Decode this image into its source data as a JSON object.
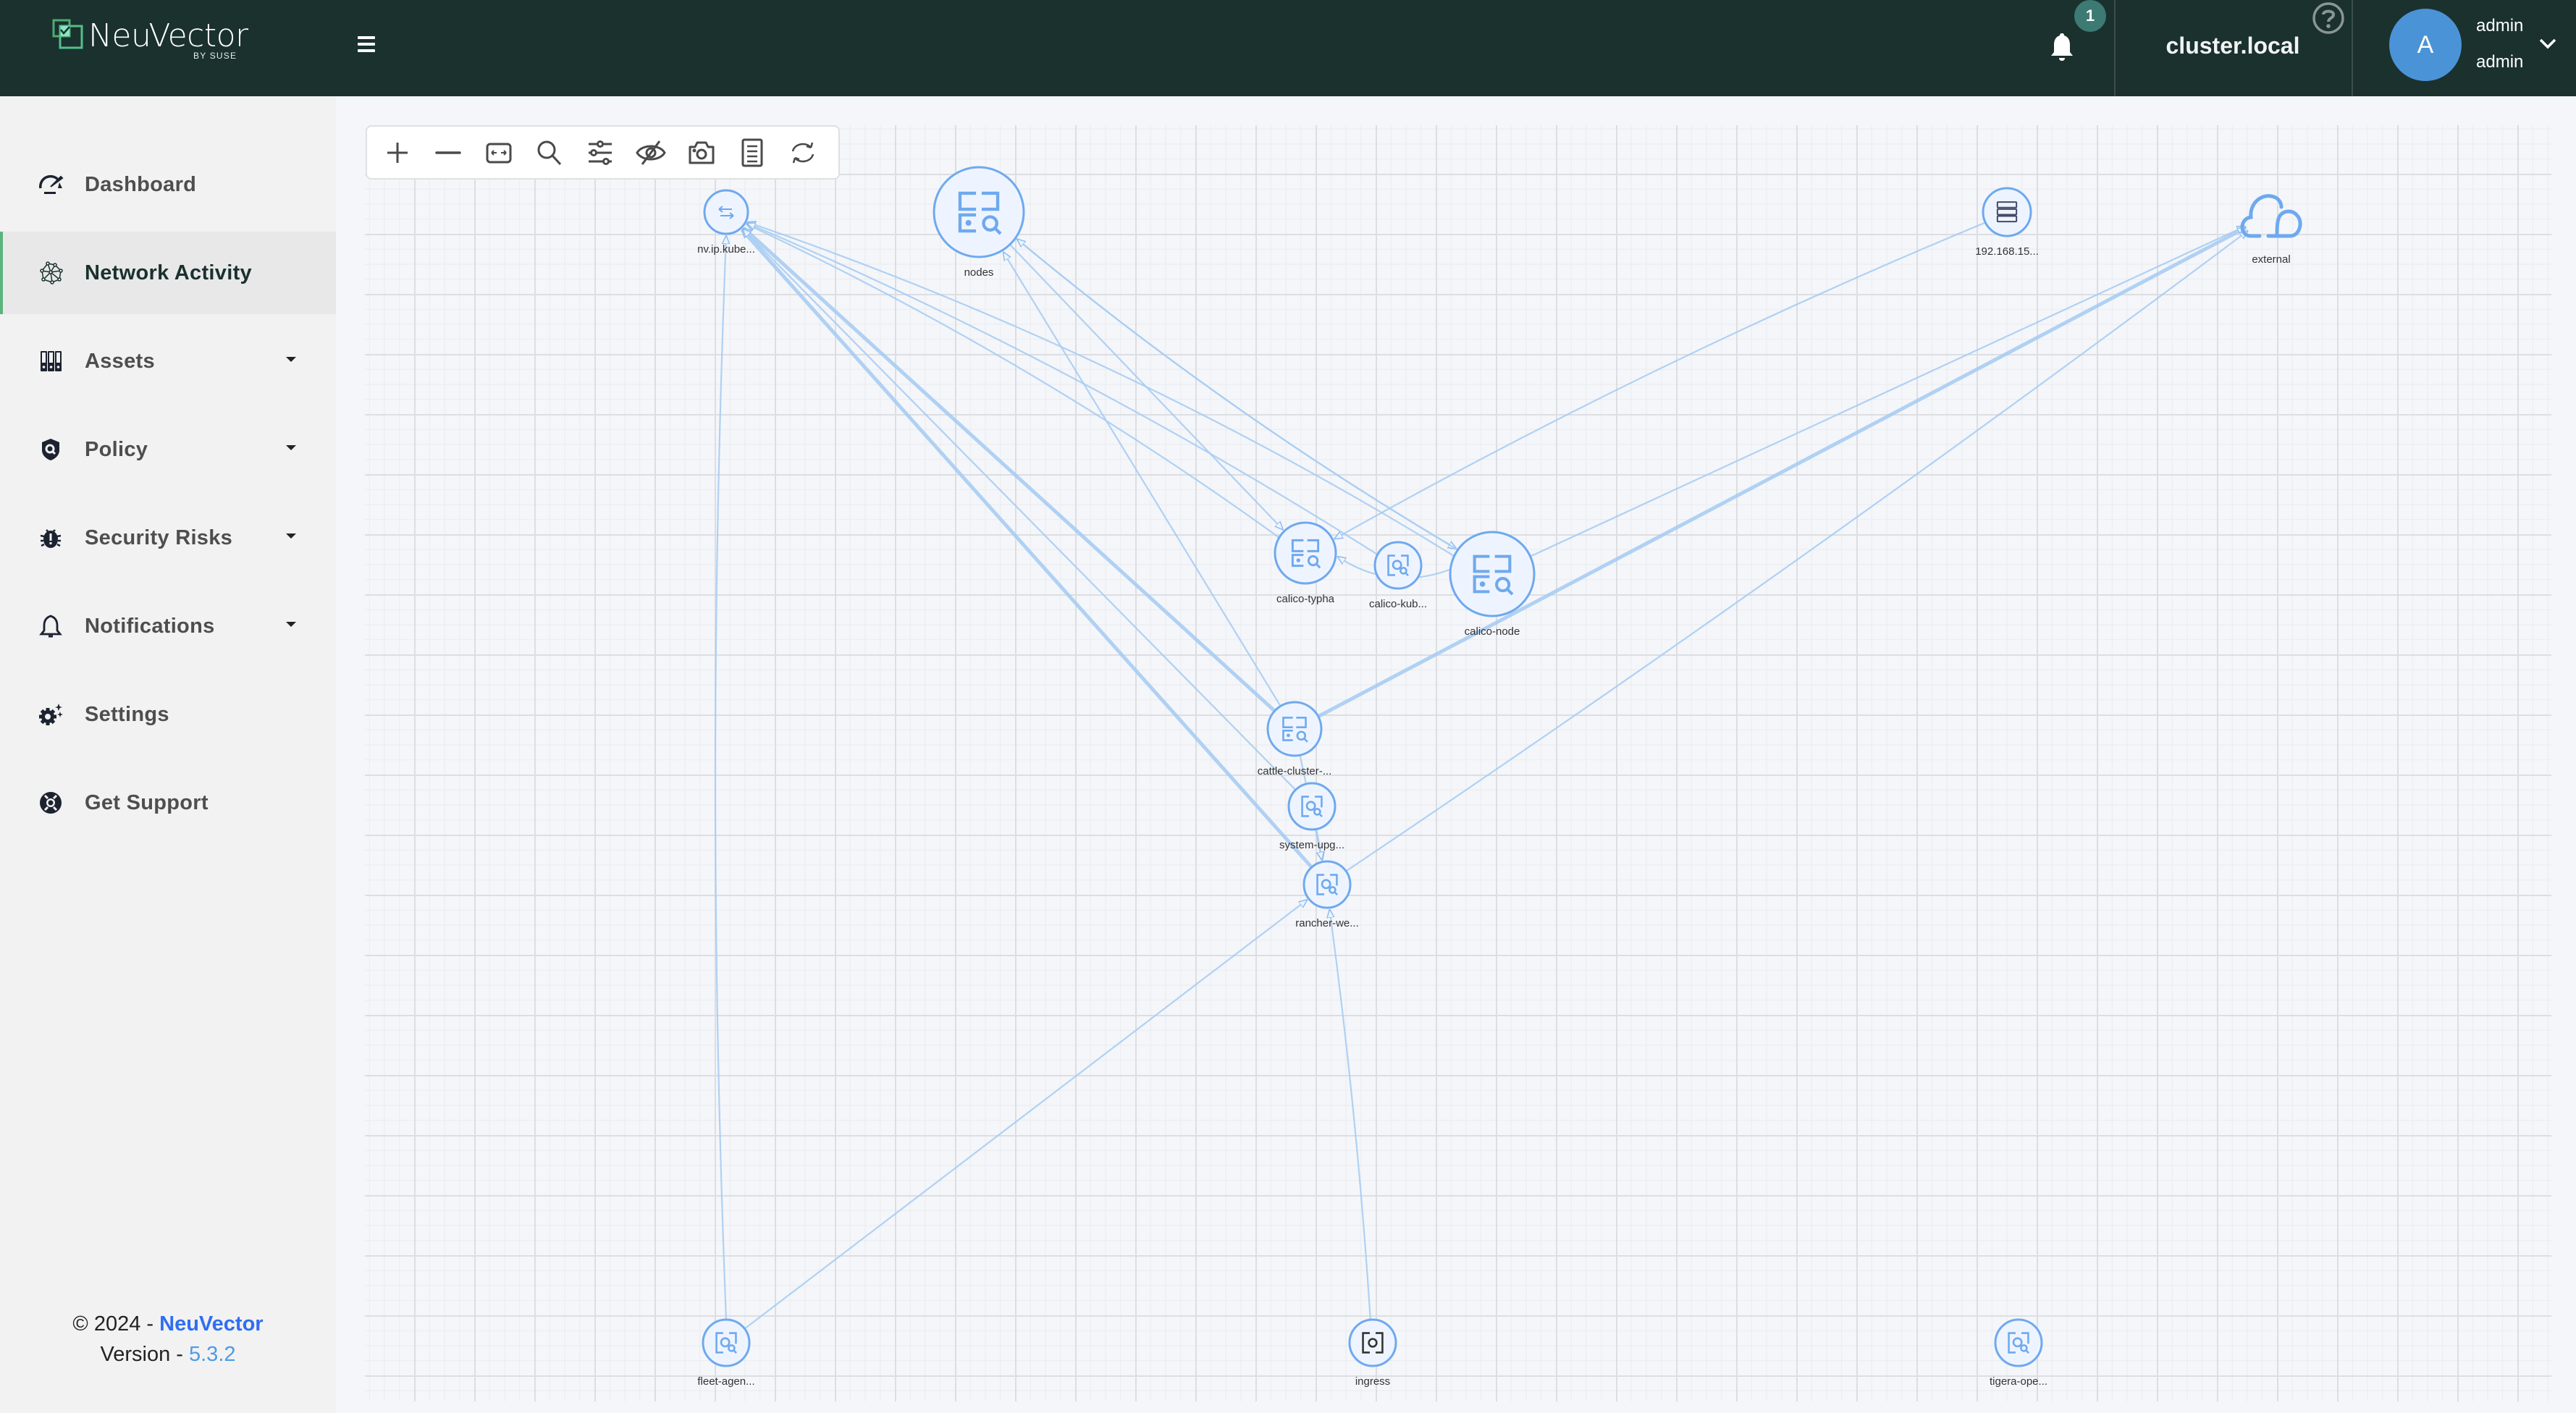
{
  "header": {
    "logo_text": "NeuVector",
    "logo_sub": "BY SUSE",
    "notification_count": "1",
    "cluster_name": "cluster.local",
    "avatar_initial": "A",
    "user_name": "admin",
    "user_role": "admin"
  },
  "sidebar": {
    "items": [
      {
        "label": "Dashboard",
        "icon": "dashboard-gauge-icon",
        "active": false,
        "has_submenu": false
      },
      {
        "label": "Network Activity",
        "icon": "network-activity-icon",
        "active": true,
        "has_submenu": false
      },
      {
        "label": "Assets",
        "icon": "assets-icon",
        "active": false,
        "has_submenu": true
      },
      {
        "label": "Policy",
        "icon": "policy-shield-icon",
        "active": false,
        "has_submenu": true
      },
      {
        "label": "Security Risks",
        "icon": "bug-icon",
        "active": false,
        "has_submenu": true
      },
      {
        "label": "Notifications",
        "icon": "bell-icon",
        "active": false,
        "has_submenu": true
      },
      {
        "label": "Settings",
        "icon": "gear-icon",
        "active": false,
        "has_submenu": false
      },
      {
        "label": "Get Support",
        "icon": "lifebuoy-icon",
        "active": false,
        "has_submenu": false
      }
    ],
    "footer": {
      "copyright": "© 2024 - ",
      "brand_link": "NeuVector",
      "version_label": "Version - ",
      "version": "5.3.2"
    }
  },
  "toolbar": {
    "buttons": [
      {
        "name": "zoom-in",
        "icon": "plus-icon"
      },
      {
        "name": "zoom-out",
        "icon": "minus-icon"
      },
      {
        "name": "fit-view",
        "icon": "fit-width-icon"
      },
      {
        "name": "search",
        "icon": "search-icon"
      },
      {
        "name": "filter",
        "icon": "sliders-icon"
      },
      {
        "name": "hide",
        "icon": "eye-off-icon"
      },
      {
        "name": "snapshot",
        "icon": "camera-icon"
      },
      {
        "name": "legend",
        "icon": "list-document-icon"
      },
      {
        "name": "refresh",
        "icon": "refresh-icon"
      }
    ]
  },
  "graph": {
    "colors": {
      "node_stroke": "#6ea9ef",
      "node_fill": "#eef4ff",
      "edge": "#a9cdf3",
      "arrow": "#80b6ef"
    },
    "nodes": [
      {
        "id": "nvip",
        "label": "nv.ip.kube...",
        "type": "ip-service"
      },
      {
        "id": "nodes",
        "label": "nodes",
        "type": "group"
      },
      {
        "id": "ip192",
        "label": "192.168.15...",
        "type": "host"
      },
      {
        "id": "external",
        "label": "external",
        "type": "external"
      },
      {
        "id": "typha",
        "label": "calico-typha",
        "type": "group"
      },
      {
        "id": "kubectrl",
        "label": "calico-kub...",
        "type": "workload"
      },
      {
        "id": "calnode",
        "label": "calico-node",
        "type": "group"
      },
      {
        "id": "cattle",
        "label": "cattle-cluster-...",
        "type": "group"
      },
      {
        "id": "sysupg",
        "label": "system-upg...",
        "type": "workload"
      },
      {
        "id": "rancher",
        "label": "rancher-we...",
        "type": "workload"
      },
      {
        "id": "fleet",
        "label": "fleet-agen...",
        "type": "workload"
      },
      {
        "id": "ingress",
        "label": "ingress",
        "type": "ingress"
      },
      {
        "id": "tigera",
        "label": "tigera-ope...",
        "type": "workload"
      }
    ],
    "edges": [
      {
        "from": "fleet",
        "to": "nvip"
      },
      {
        "from": "cattle",
        "to": "nvip"
      },
      {
        "from": "rancher",
        "to": "nvip"
      },
      {
        "from": "sysupg",
        "to": "nvip"
      },
      {
        "from": "typha",
        "to": "nvip"
      },
      {
        "from": "calnode",
        "to": "nvip"
      },
      {
        "from": "kubectrl",
        "to": "nvip"
      },
      {
        "from": "cattle",
        "to": "nodes"
      },
      {
        "from": "nodes",
        "to": "typha"
      },
      {
        "from": "nodes",
        "to": "calnode"
      },
      {
        "from": "calnode",
        "to": "nodes"
      },
      {
        "from": "ip192",
        "to": "typha"
      },
      {
        "from": "calnode",
        "to": "typha"
      },
      {
        "from": "calnode",
        "to": "external"
      },
      {
        "from": "cattle",
        "to": "external"
      },
      {
        "from": "rancher",
        "to": "external"
      },
      {
        "from": "sysupg",
        "to": "rancher"
      },
      {
        "from": "cattle",
        "to": "rancher"
      },
      {
        "from": "fleet",
        "to": "rancher"
      },
      {
        "from": "ingress",
        "to": "rancher"
      }
    ]
  }
}
